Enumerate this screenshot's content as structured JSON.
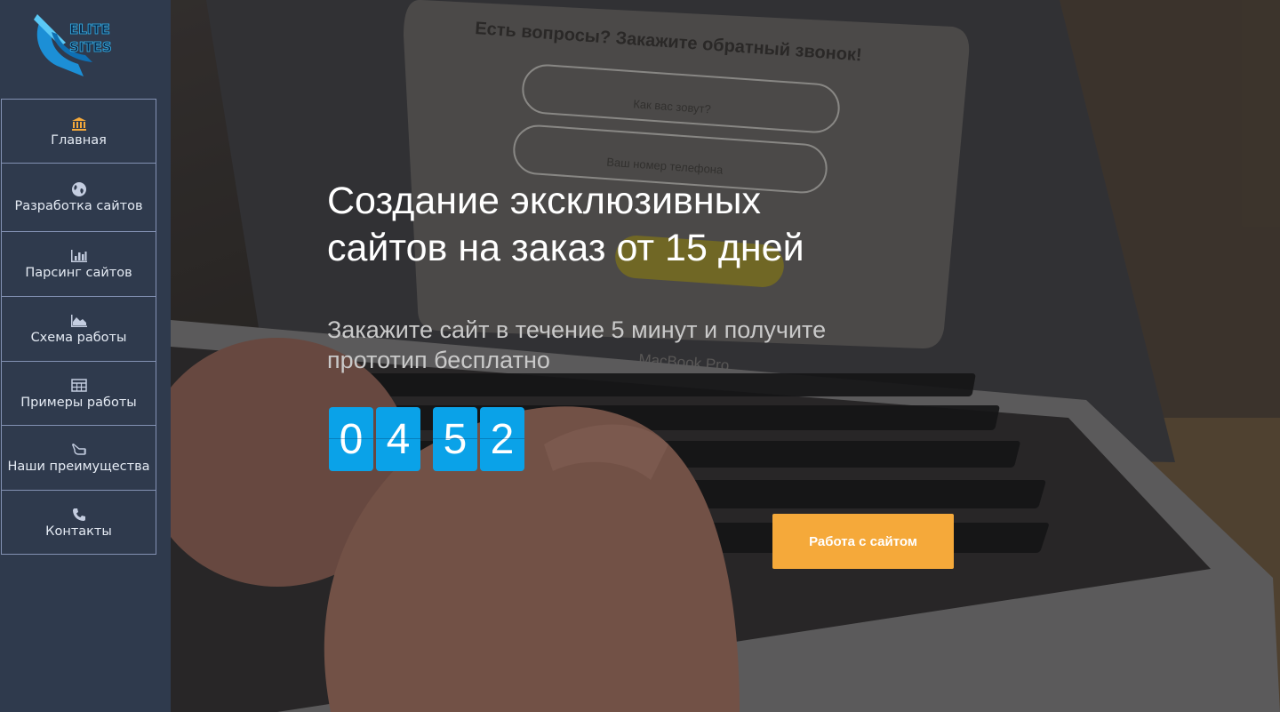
{
  "sidebar": {
    "logo_text": "ELITE SITES",
    "items": [
      {
        "label": "Главная",
        "icon": "bank-icon"
      },
      {
        "label": "Разработка сайтов",
        "icon": "globe-icon"
      },
      {
        "label": "Парсинг сайтов",
        "icon": "bar-chart-icon"
      },
      {
        "label": "Схема работы",
        "icon": "area-chart-icon"
      },
      {
        "label": "Примеры работы",
        "icon": "table-icon"
      },
      {
        "label": "Наши преимущества",
        "icon": "hand-pointer-icon"
      },
      {
        "label": "Контакты",
        "icon": "phone-icon"
      }
    ]
  },
  "hero": {
    "background": {
      "form_heading": "Есть вопросы? Закажите обратный звонок!",
      "name_placeholder": "Как вас зовут?",
      "phone_placeholder": "Ваш номер телефона",
      "laptop_label": "MacBook Pro"
    },
    "title_line1": "Создание эксклюзивных",
    "title_line2": "сайтов на заказ от 15 дней",
    "subtitle": "Закажите сайт в течение 5 минут и получите прототип бесплатно",
    "timer": [
      "0",
      "4",
      "5",
      "2"
    ],
    "cta_label": "Работа с сайтом"
  },
  "colors": {
    "sidebar_bg": "#2f3a4d",
    "accent_orange": "#f5a93a",
    "timer_blue": "#0aa2e8",
    "active_icon": "#f5a93a"
  }
}
